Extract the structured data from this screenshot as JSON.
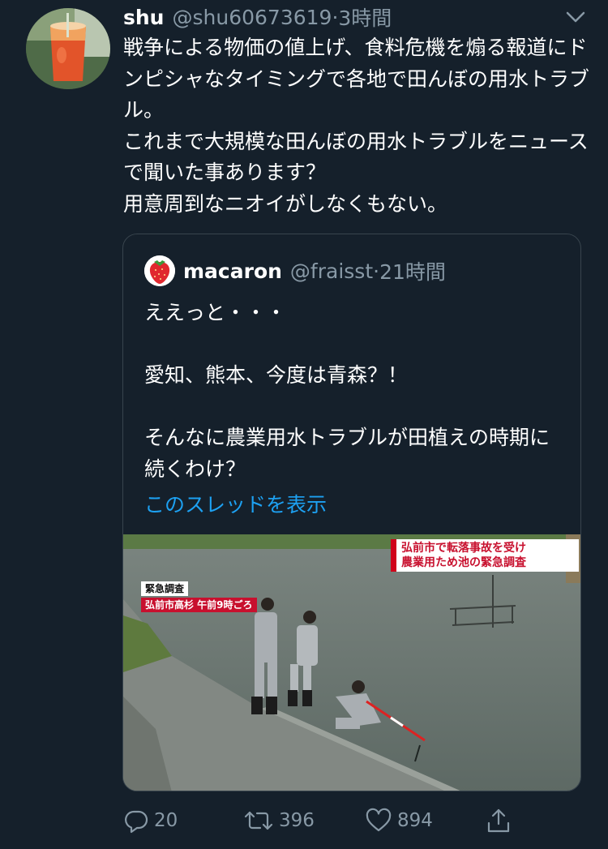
{
  "tweet": {
    "display_name": "shu",
    "handle": "@shu60673619",
    "separator": "·",
    "time": "3時間",
    "text": "戦争による物価の値上げ、食料危機を煽る報道にドンピシャなタイミングで各地で田んぼの用水トラブル。\nこれまで大規模な田んぼの用水トラブルをニュースで聞いた事あります？\n用意周到なニオイがしなくもない。"
  },
  "quoted": {
    "display_name": "macaron",
    "handle": "@fraisst",
    "separator": "·",
    "time": "21時間",
    "text": "ええっと・・・\n\n愛知、熊本、今度は青森？！\n\nそんなに農業用水トラブルが田植えの時期に続くわけ？",
    "show_thread": "このスレッドを表示",
    "media": {
      "caption_line1": "弘前市で転落事故を受け",
      "caption_line2": "農業用ため池の緊急調査",
      "tag_urgent": "緊急調査",
      "tag_place": "弘前市高杉 午前9時ごろ"
    }
  },
  "actions": {
    "reply_count": "20",
    "retweet_count": "396",
    "like_count": "894"
  },
  "colors": {
    "background": "#15202b",
    "secondary_text": "#8899a6",
    "link": "#1da1f2",
    "border": "#38444d",
    "news_red": "#c8102e"
  },
  "icons": [
    "reply-icon",
    "retweet-icon",
    "like-icon",
    "share-icon",
    "chevron-down-icon",
    "strawberry-icon"
  ]
}
